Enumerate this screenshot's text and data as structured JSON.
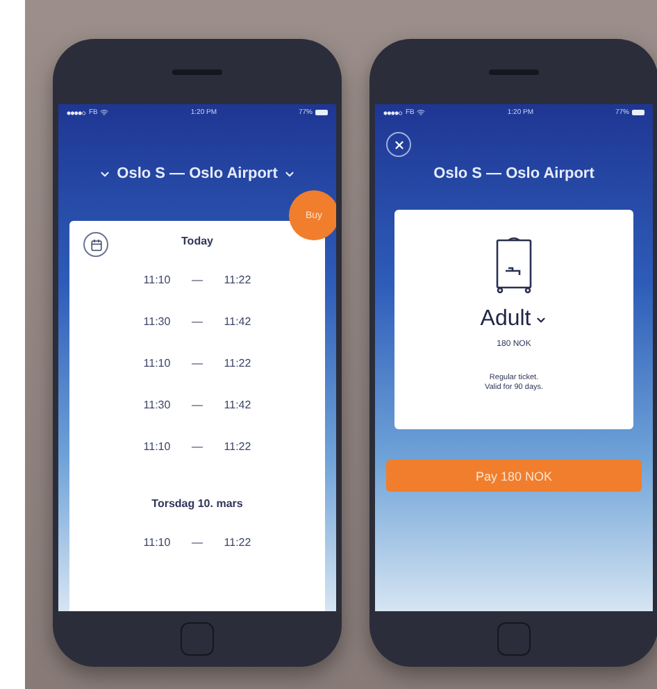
{
  "phones": [
    {
      "kind": "departures",
      "status": {
        "carrier": "FB",
        "time": "1:20 PM",
        "battery": "77%"
      },
      "route": "Oslo S — Oslo Airport",
      "buy": "Buy",
      "days": [
        {
          "label": "Today",
          "trips": [
            {
              "depart": "11:10",
              "dash": "—",
              "arrive": "11:22"
            },
            {
              "depart": "11:30",
              "dash": "—",
              "arrive": "11:42"
            },
            {
              "depart": "11:10",
              "dash": "—",
              "arrive": "11:22"
            },
            {
              "depart": "11:30",
              "dash": "—",
              "arrive": "11:42"
            },
            {
              "depart": "11:10",
              "dash": "—",
              "arrive": "11:22"
            }
          ]
        },
        {
          "label": "Torsdag 10. mars",
          "trips": [
            {
              "depart": "11:10",
              "dash": "—",
              "arrive": "11:22"
            }
          ]
        }
      ]
    },
    {
      "kind": "ticket",
      "status": {
        "carrier": "FB",
        "time": "1:20 PM",
        "battery": "77%"
      },
      "route": "Oslo S — Oslo Airport",
      "ticket": {
        "type": "Adult",
        "price": "180 NOK",
        "note_lines": [
          "Regular ticket.",
          "Valid for 90 days."
        ]
      },
      "pay": "Pay 180 NOK"
    }
  ]
}
